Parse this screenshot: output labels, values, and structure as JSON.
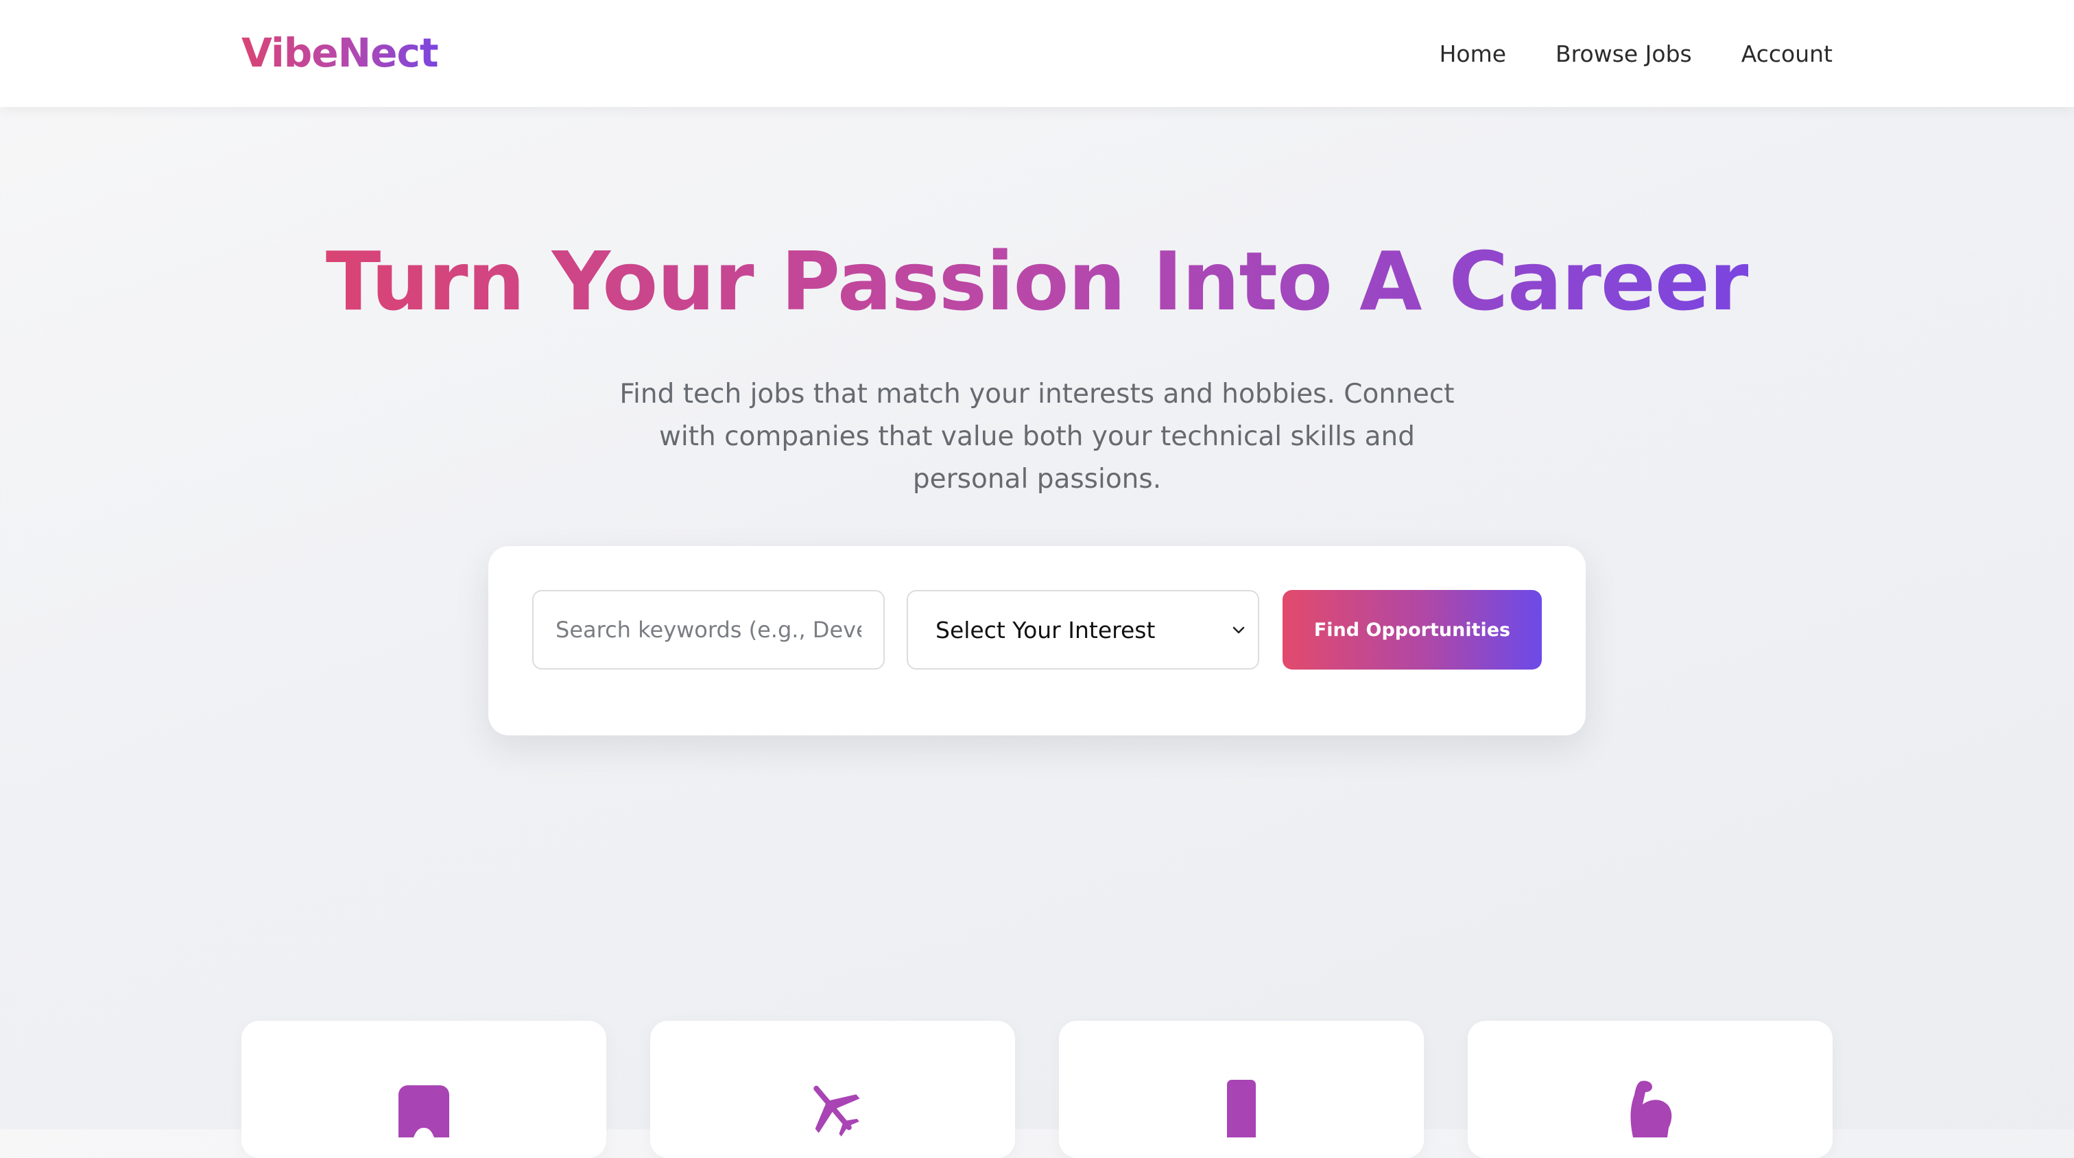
{
  "brand": {
    "name": "VibeNect"
  },
  "nav": {
    "items": [
      {
        "label": "Home"
      },
      {
        "label": "Browse Jobs"
      },
      {
        "label": "Account"
      }
    ]
  },
  "hero": {
    "title": "Turn Your Passion Into A Career",
    "subtitle": "Find tech jobs that match your interests and hobbies. Connect with companies that value both your technical skills and personal passions."
  },
  "search": {
    "placeholder": "Search keywords (e.g., Developer, Designer)",
    "interest_label": "Select Your Interest",
    "button_label": "Find Opportunities"
  },
  "categories": [
    {
      "icon": "gamepad-icon"
    },
    {
      "icon": "airplane-icon"
    },
    {
      "icon": "mobile-phone-icon"
    },
    {
      "icon": "flexed-bicep-icon"
    }
  ],
  "colors": {
    "gradient_start": "#d94474",
    "gradient_mid": "#b848a9",
    "gradient_end": "#7b45e0",
    "icon_color": "#a13fb8"
  }
}
